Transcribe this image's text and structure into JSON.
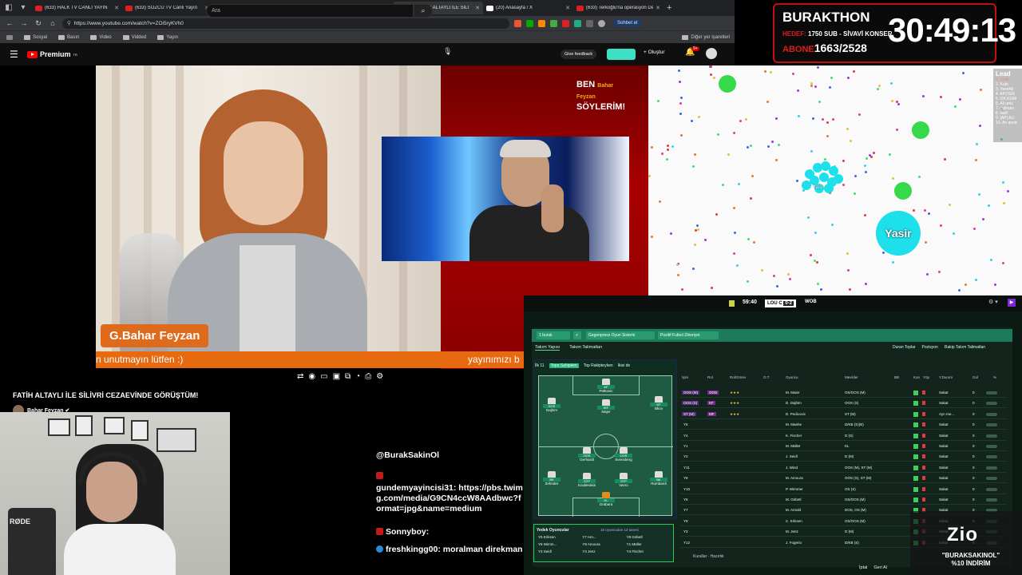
{
  "browser": {
    "tabs": [
      {
        "label": "(633) HALK TV CANLI YAYIN",
        "icon_color": "#e02020"
      },
      {
        "label": "(633) SÖZCÜ TV Canlı Yayın",
        "icon_color": "#e02020"
      },
      {
        "label": "(21) Anasayfa / X",
        "icon_color": "#ffffff"
      },
      {
        "label": "Multi TV – 10 haber kanalın",
        "icon_color": "#4aa3ff"
      },
      {
        "label": "(633) FATİH ALTAYLI İLE SİLİ",
        "icon_color": "#e02020",
        "active": true
      },
      {
        "label": "(20) Anasayfa / X",
        "icon_color": "#ffffff"
      },
      {
        "label": "(633) Terkoğlu'na operasyon De",
        "icon_color": "#e02020"
      }
    ],
    "url": "https://www.youtube.com/watch?v=ZOi5ryKVh0",
    "chat_button": "Sohbet et",
    "bookmarks": [
      "Sosyal",
      "Basın",
      "Video",
      "Vidded",
      "Yayın"
    ],
    "other_bookmarks": "Diğer yer işaretleri"
  },
  "youtube": {
    "logo_text": "Premium",
    "logo_sup": "TR",
    "search_placeholder": "Ara",
    "give_feedback": "Give feedback",
    "create_label": "+ Oluştur",
    "notif_count": "9+",
    "video_title": "FATİH ALTAYLI İLE SİLİVRİ CEZAEVİNDE GÖRÜŞTÜM!",
    "channel_name": "Bahar Feyzan ✔"
  },
  "video": {
    "brand_line1": "BEN",
    "brand_small": "Bahar Feyzan",
    "brand_line2": "SÖYLERİM!",
    "name_tag": "G.Bahar Feyzan",
    "ticker_left": "n unutmayın lütfen :)",
    "ticker_right": "yayınımızı b"
  },
  "chat": {
    "messages": [
      {
        "user": "@BurakSakinOl",
        "text": "",
        "badge": "none"
      },
      {
        "user": "",
        "text": "",
        "badge": "red"
      },
      {
        "user": "gundemyayincisi31:",
        "text": "https://pbs.twimg.com/media/G9CN4ccW8AAdbwc?format=jpg&name=medium",
        "badge": "none"
      },
      {
        "user": "Sonnyboy:",
        "text": "",
        "badge": "red"
      },
      {
        "user": "freshkingg00:",
        "text": "moralman direkman",
        "badge": "blue"
      }
    ]
  },
  "timer": {
    "title": "BURAKTHON",
    "hedef_label": "HEDEF:",
    "hedef_value": "1750 SUB - SİVAVİ KONSER",
    "abone_label": "ABONE",
    "abone_value": "1663/2528",
    "clock": "30:49:13"
  },
  "agar": {
    "player_name": "Yasir",
    "cluster_name": "Yasir",
    "leaderboard_title": "Lead",
    "leaderboard": [
      "1. Yasir",
      "2. Kubi",
      "3. YasirAli",
      "4. APOSİK",
      "5. OK KEMI",
      "6. Ali umu",
      "7. çalmanı",
      "8. sadi",
      "9. [AP] ALİ",
      "10. An annic"
    ]
  },
  "fm": {
    "match_time": "59:40",
    "home": "LOU C",
    "score": "0-2",
    "away": "WOB",
    "header_buttons": [
      "1 buruk",
      "+",
      "Gegenpress Oyun Sistemi",
      "Pozitif Futbol Ziheriyet"
    ],
    "tabs": [
      "Takım Yapısı",
      "Takım Talimatları"
    ],
    "actions": [
      "Duran Toplar",
      "Pozisyon",
      "Rakip Takım Talimatları"
    ],
    "pitch_tabs": [
      "İlk 11",
      "Topa Sahipken",
      "Top Rakipteyken",
      "İkisi de"
    ],
    "players_on_pitch": [
      {
        "pos": "KF",
        "name": "Petkovic"
      },
      {
        "pos": "DOS",
        "name": "Dajhim"
      },
      {
        "pos": "IKF",
        "name": "Majer"
      },
      {
        "pos": "KF",
        "name": "Bkov"
      },
      {
        "pos": "OOS",
        "name": "Gerhardt"
      },
      {
        "pos": "OOS",
        "name": "Svensberg"
      },
      {
        "pos": "BK",
        "name": "Zehnder"
      },
      {
        "pos": "STP",
        "name": "Koulierakis"
      },
      {
        "pos": "STP",
        "name": "Vavro"
      },
      {
        "pos": "BK",
        "name": "Rumbardi"
      },
      {
        "pos": "KL",
        "name": "Grabara"
      }
    ],
    "subs_title": "Yedek Oyuncular",
    "subs_count": "15 oyuncudan 12 tanesi",
    "subs": [
      "Y5 Eriksen",
      "Y7 Arn...",
      "Y8 Göbetl",
      "Y6 Wimm...",
      "Y9 Amoura",
      "Y1 Müller",
      "Y3 Seidl",
      "Y4 Jenz",
      "Y4 Fischer"
    ],
    "table_headers": [
      "İşim",
      "Rol",
      "Rol/Görev",
      "O.T",
      "Oyuncu",
      "Mevkiler",
      "BB",
      "Kon",
      "Yöp",
      "Y.Durum",
      "Gol",
      "%"
    ],
    "rows": [
      {
        "pos": "OOS (M)",
        "role": "OOS",
        "stars": "★★★",
        "name": "M. Maier",
        "posns": "OS/OOS (M)",
        "st": "Sakat",
        "num": "0",
        "sel": true
      },
      {
        "pos": "OOS (S)",
        "role": "KF",
        "stars": "★★★",
        "name": "D. Dajhim",
        "posns": "OOS (S)",
        "st": "Sakat",
        "num": "0",
        "sel": true
      },
      {
        "pos": "ST (M)",
        "role": "MF",
        "stars": "★★★",
        "name": "D. Pedicovic",
        "posns": "ST (M)",
        "st": "Ayrı me...",
        "num": "0",
        "sel": true
      },
      {
        "pos": "Y5",
        "role": "",
        "stars": "",
        "name": "M. Maehe",
        "posns": "D/KB (S)(B)",
        "st": "Sakat",
        "num": "0",
        "sel": false
      },
      {
        "pos": "Y4",
        "role": "",
        "stars": "",
        "name": "K. Fischer",
        "posns": "D (S)",
        "st": "Sakat",
        "num": "0",
        "sel": false
      },
      {
        "pos": "Y1",
        "role": "",
        "stars": "",
        "name": "M. Müller",
        "posns": "KL",
        "st": "Sakat",
        "num": "0",
        "sel": false
      },
      {
        "pos": "Y2",
        "role": "",
        "stars": "",
        "name": "J. Seidl",
        "posns": "D (M)",
        "st": "Sakat",
        "num": "0",
        "sel": false
      },
      {
        "pos": "Y11",
        "role": "",
        "stars": "",
        "name": "J. Wind",
        "posns": "OOS (M), ST (M)",
        "st": "Sakat",
        "num": "0",
        "sel": false
      },
      {
        "pos": "Y8",
        "role": "",
        "stars": "",
        "name": "M. Amoura",
        "posns": "OOS (S), ST (M)",
        "st": "Sakat",
        "num": "0",
        "sel": false
      },
      {
        "pos": "Y10",
        "role": "",
        "stars": "",
        "name": "P. Wimmer",
        "posns": "OS (S)",
        "st": "Sakat",
        "num": "0",
        "sel": false
      },
      {
        "pos": "Y6",
        "role": "",
        "stars": "",
        "name": "M. Göbetl",
        "posns": "OS/OOS (M)",
        "st": "Sakat",
        "num": "0",
        "sel": false
      },
      {
        "pos": "Y7",
        "role": "",
        "stars": "",
        "name": "M. Arnold",
        "posns": "DOS, OS (M)",
        "st": "Sakat",
        "num": "0",
        "sel": false
      },
      {
        "pos": "Y9",
        "role": "",
        "stars": "",
        "name": "C. Eriksen",
        "posns": "OS/OOS (M)",
        "st": "Sakat",
        "num": "0",
        "sel": false
      },
      {
        "pos": "Y3",
        "role": "",
        "stars": "",
        "name": "M. Jenz",
        "posns": "D (M)",
        "st": "Sakat",
        "num": "0",
        "sel": false
      },
      {
        "pos": "Y12",
        "role": "",
        "stars": "",
        "name": "J. Fogerio",
        "posns": "D/KB (S)",
        "st": "Sakat",
        "num": "0",
        "sel": false
      }
    ],
    "bottom_label": "Kurallar · Hazırlık",
    "bottom_buttons": [
      "İptal",
      "Geri Al"
    ]
  },
  "ad": {
    "logo": "Zio",
    "line1": "\"BURAKSAKINOL\"",
    "line2": "%10 İNDİRİM"
  }
}
